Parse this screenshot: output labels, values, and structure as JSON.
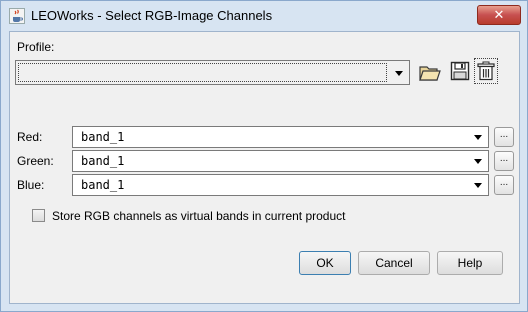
{
  "window": {
    "title": "LEOWorks - Select RGB-Image Channels",
    "close_label": "✕"
  },
  "profile": {
    "label": "Profile:",
    "value": ""
  },
  "channels": [
    {
      "label": "Red:",
      "value": "band_1",
      "browse_label": "..."
    },
    {
      "label": "Green:",
      "value": "band_1",
      "browse_label": "..."
    },
    {
      "label": "Blue:",
      "value": "band_1",
      "browse_label": "..."
    }
  ],
  "options": {
    "virtual_bands_label": "Store RGB channels as virtual bands in current product",
    "virtual_bands_checked": false
  },
  "buttons": {
    "ok": "OK",
    "cancel": "Cancel",
    "help": "Help"
  },
  "icons": {
    "app": "java-cup-icon",
    "open": "folder-open-icon",
    "save": "floppy-disk-icon",
    "delete": "trash-can-icon"
  }
}
